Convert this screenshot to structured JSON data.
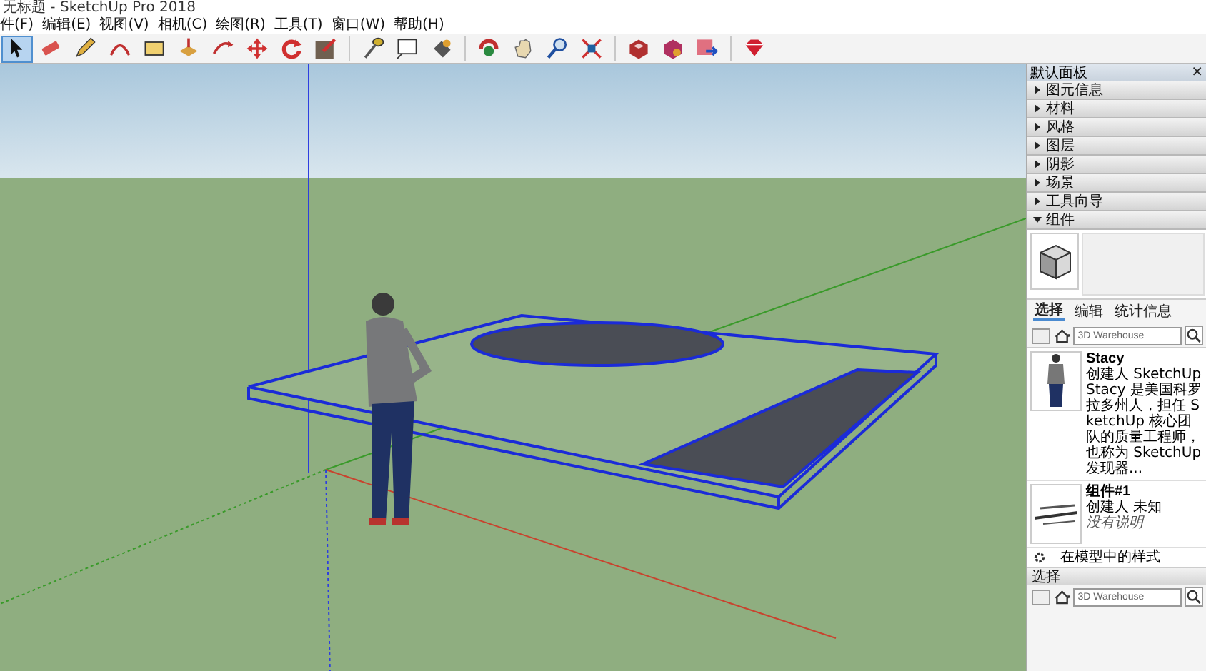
{
  "window": {
    "title": "无标题 - SketchUp Pro 2018"
  },
  "menu": [
    "件(F)",
    "编辑(E)",
    "视图(V)",
    "相机(C)",
    "绘图(R)",
    "工具(T)",
    "窗口(W)",
    "帮助(H)"
  ],
  "toolbar": [
    [
      {
        "kind": "select",
        "selected": true
      },
      {
        "kind": "eraser",
        "selected": false
      },
      {
        "kind": "pencil",
        "selected": false
      },
      {
        "kind": "arc",
        "selected": false
      },
      {
        "kind": "rectangle",
        "selected": false
      },
      {
        "kind": "pushpull",
        "selected": false
      },
      {
        "kind": "offset",
        "selected": false
      },
      {
        "kind": "move",
        "selected": false
      },
      {
        "kind": "rotate",
        "selected": false
      },
      {
        "kind": "scale",
        "selected": false
      }
    ],
    [
      {
        "kind": "tape",
        "selected": false
      },
      {
        "kind": "text",
        "selected": false
      },
      {
        "kind": "paint",
        "selected": false
      }
    ],
    [
      {
        "kind": "orbit",
        "selected": false
      },
      {
        "kind": "pan",
        "selected": false
      },
      {
        "kind": "zoom",
        "selected": false
      },
      {
        "kind": "extents",
        "selected": false
      }
    ],
    [
      {
        "kind": "warehouse",
        "selected": false
      },
      {
        "kind": "share",
        "selected": false
      },
      {
        "kind": "upload",
        "selected": false
      }
    ],
    [
      {
        "kind": "ruby",
        "selected": false
      }
    ]
  ],
  "panel": {
    "title": "默认面板",
    "close": "×",
    "sections": [
      {
        "label": "图元信息",
        "expanded": false
      },
      {
        "label": "材料",
        "expanded": false
      },
      {
        "label": "风格",
        "expanded": false
      },
      {
        "label": "图层",
        "expanded": false
      },
      {
        "label": "阴影",
        "expanded": false
      },
      {
        "label": "场景",
        "expanded": false
      },
      {
        "label": "工具向导",
        "expanded": false
      },
      {
        "label": "组件",
        "expanded": true
      }
    ],
    "tabs": [
      {
        "label": "选择",
        "selected": true
      },
      {
        "label": "编辑",
        "selected": false
      },
      {
        "label": "统计信息",
        "selected": false
      }
    ],
    "search": {
      "value": "3D Warehouse"
    },
    "items": [
      {
        "kind": "person",
        "name": "Stacy",
        "creator": "创建人 SketchUp",
        "description": "Stacy 是美国科罗拉多州人，担任 SketchUp 核心团队的质量工程师，也称为 SketchUp 发现器..."
      },
      {
        "kind": "component",
        "name": "组件#1",
        "creator": "创建人 未知",
        "description": "没有说明"
      }
    ],
    "footer": "在模型中的样式",
    "second": {
      "label": "选择",
      "search": {
        "value": "3D Warehouse"
      }
    }
  }
}
